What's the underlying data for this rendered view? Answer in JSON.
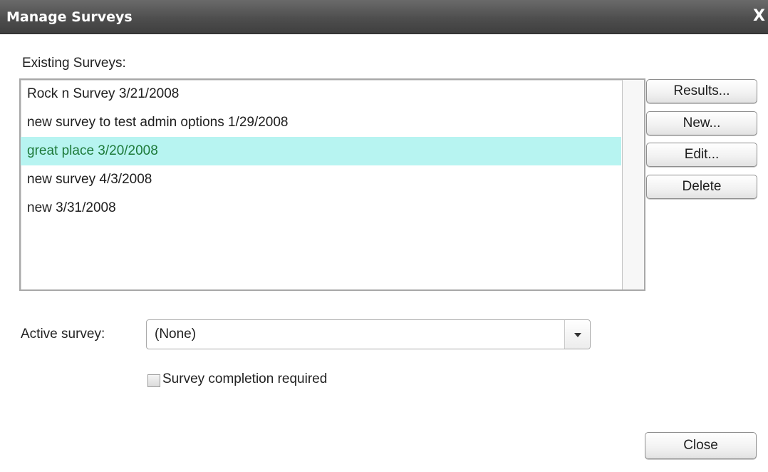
{
  "window": {
    "title": "Manage Surveys",
    "close_glyph": "X"
  },
  "existing": {
    "label": "Existing Surveys:",
    "items": [
      {
        "label": "Rock n Survey 3/21/2008",
        "selected": false
      },
      {
        "label": "new survey to test admin options 1/29/2008",
        "selected": false
      },
      {
        "label": "great place 3/20/2008",
        "selected": true
      },
      {
        "label": "new survey 4/3/2008",
        "selected": false
      },
      {
        "label": "new 3/31/2008",
        "selected": false
      }
    ],
    "selection_color": "#b7f4f1",
    "selection_text_color": "#1d7a3a"
  },
  "buttons": {
    "results": "Results...",
    "new": "New...",
    "edit": "Edit...",
    "delete": "Delete",
    "close": "Close"
  },
  "active": {
    "label": "Active survey:",
    "value": "(None)"
  },
  "completion": {
    "label": "Survey completion required",
    "checked": false
  }
}
